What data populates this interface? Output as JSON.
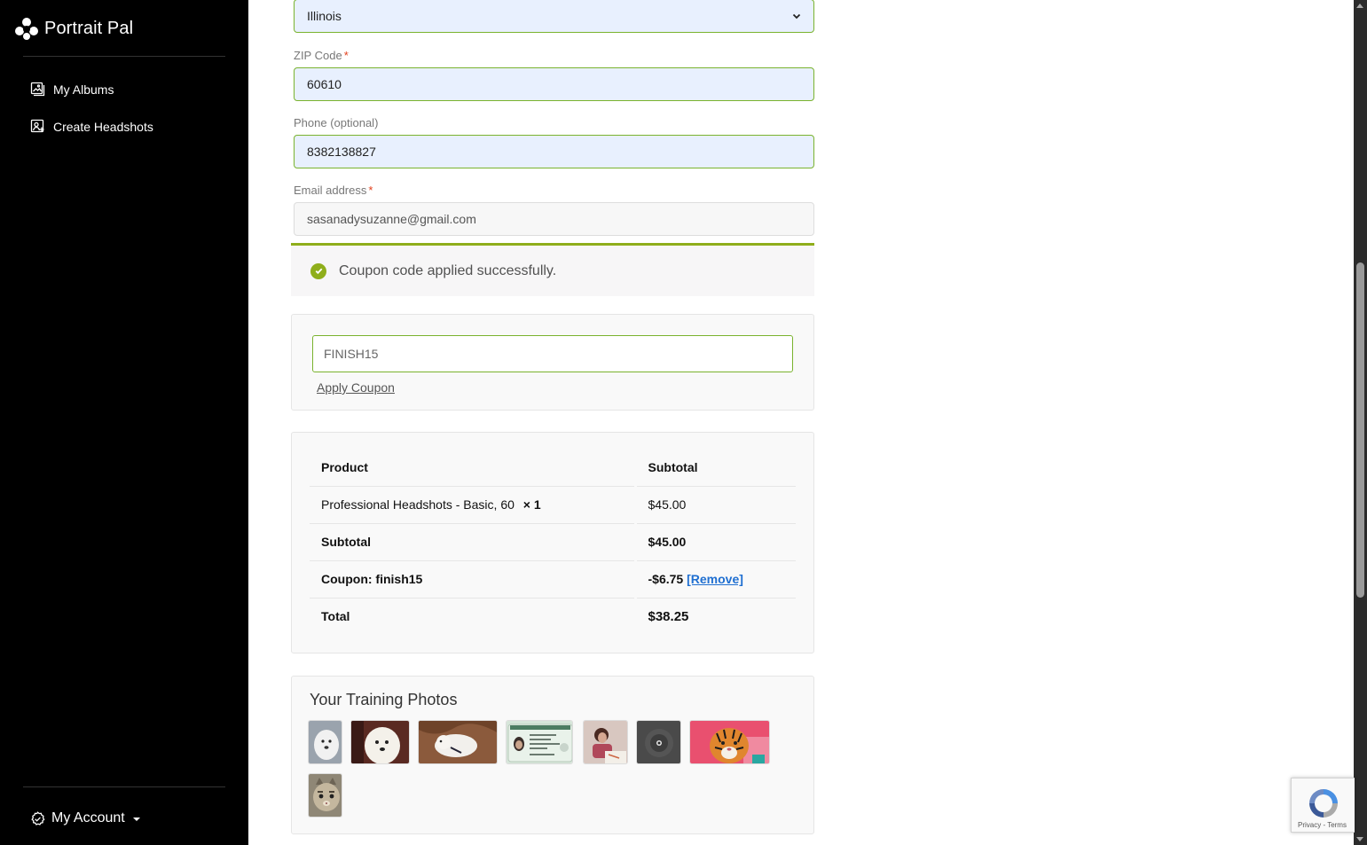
{
  "app": {
    "name": "Portrait Pal"
  },
  "sidebar": {
    "items": [
      {
        "label": "My Albums",
        "icon": "albums-icon"
      },
      {
        "label": "Create Headshots",
        "icon": "create-headshots-icon"
      }
    ],
    "account_label": "My Account"
  },
  "form": {
    "state": {
      "value": "Illinois"
    },
    "zip": {
      "label": "ZIP Code",
      "required": "*",
      "value": "60610"
    },
    "phone": {
      "label": "Phone (optional)",
      "value": "8382138827"
    },
    "email": {
      "label": "Email address",
      "required": "*",
      "value": "sasanadysuzanne@gmail.com"
    }
  },
  "notice": {
    "text": "Coupon code applied successfully."
  },
  "coupon": {
    "value": "FINISH15",
    "apply_label": "Apply Coupon"
  },
  "order": {
    "headers": {
      "product": "Product",
      "subtotal": "Subtotal"
    },
    "item": {
      "name": "Professional Headshots - Basic, 60",
      "qty": "× 1",
      "price": "$45.00"
    },
    "subtotal": {
      "label": "Subtotal",
      "value": "$45.00"
    },
    "coupon_line": {
      "label": "Coupon: finish15",
      "value": "-$6.75",
      "remove_label": "[Remove]"
    },
    "total": {
      "label": "Total",
      "value": "$38.25"
    }
  },
  "photos": {
    "title": "Your Training Photos",
    "items": [
      {
        "subject": "white puppy"
      },
      {
        "subject": "fluffy white dog"
      },
      {
        "subject": "dog on rug"
      },
      {
        "subject": "id card"
      },
      {
        "subject": "girl drawing"
      },
      {
        "subject": "dark ring"
      },
      {
        "subject": "tiger on pink"
      },
      {
        "subject": "cat face"
      }
    ]
  },
  "recaptcha": {
    "links": "Privacy - Terms"
  },
  "colors": {
    "accent_green": "#7ab32e",
    "notice_green": "#8fae1b",
    "link_blue": "#1f6fd1",
    "sidebar_bg": "#000000"
  }
}
